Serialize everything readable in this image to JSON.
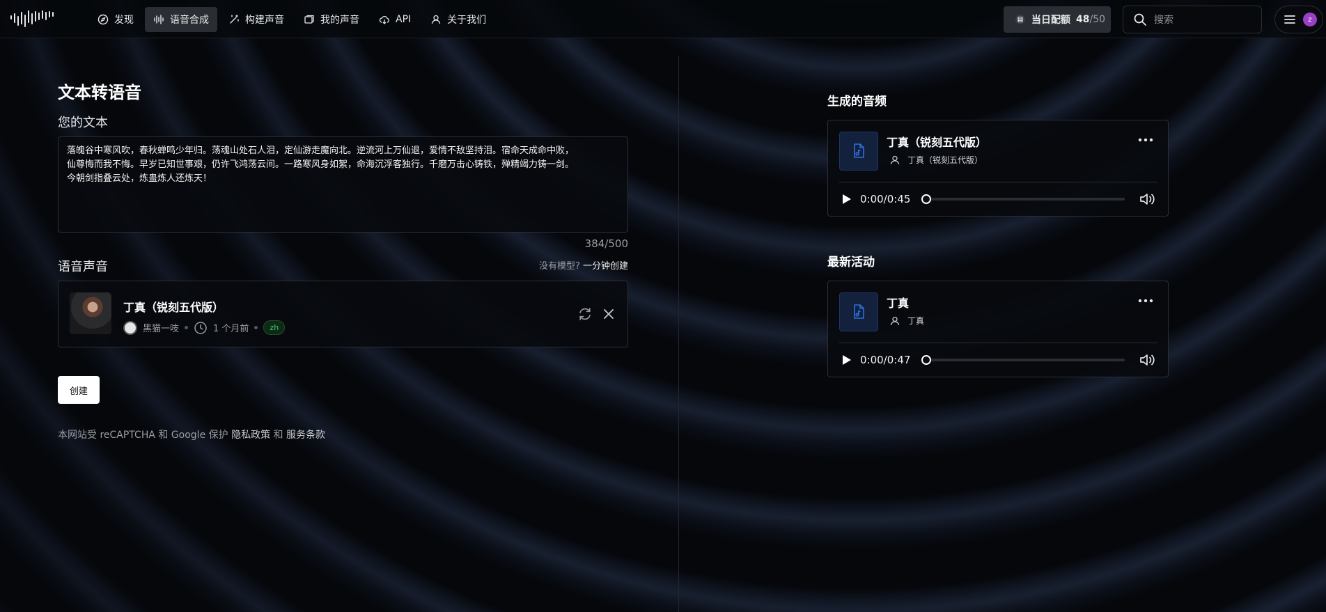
{
  "nav": {
    "items": [
      {
        "label": "发现",
        "icon": "compass-icon"
      },
      {
        "label": "语音合成",
        "icon": "waveform-icon",
        "active": true
      },
      {
        "label": "构建声音",
        "icon": "magic-wand-icon"
      },
      {
        "label": "我的声音",
        "icon": "folder-icon"
      },
      {
        "label": "API",
        "icon": "cloud-icon"
      },
      {
        "label": "关于我们",
        "icon": "user-icon"
      }
    ],
    "quota_label": "当日配额",
    "quota_used": "48",
    "quota_total": "/50",
    "search_placeholder": "搜索",
    "avatar_initial": "z"
  },
  "main": {
    "title": "文本转语音",
    "text_label": "您的文本",
    "text_value": "落魄谷中寒风吹，春秋蝉鸣少年归。荡魂山处石人泪，定仙游走魔向北。逆流河上万仙退，爱情不敌坚持泪。宿命天成命中败，\n仙尊悔而我不悔。早岁已知世事艰，仍许飞鸿荡云间。一路寒风身如絮，命海沉浮客独行。千磨万击心铸铁，殚精竭力铸一剑。\n今朝剑指叠云处，炼蛊炼人还炼天！",
    "char_count": "384/500",
    "voice_label": "语音声音",
    "no_model_text": "没有模型?",
    "create_link": "一分钟创建",
    "voice": {
      "name": "丁真（锐刻五代版）",
      "author": "黑猫一吱",
      "time": "1 个月前",
      "lang": "zh"
    },
    "create_button": "创建",
    "footer_prefix": "本网站受 reCAPTCHA 和 Google 保护",
    "privacy": "隐私政策",
    "and": "和",
    "terms": "服务条款"
  },
  "side": {
    "generated_title": "生成的音频",
    "recent_title": "最新活动",
    "generated": {
      "title": "丁真（锐刻五代版）",
      "voice": "丁真（锐刻五代版）",
      "time": "0:00/0:45",
      "progress": 0
    },
    "recent": {
      "title": "丁真",
      "voice": "丁真",
      "time": "0:00/0:47",
      "progress": 0
    }
  },
  "colors": {
    "accent_icon": "#2f6fe0",
    "lang_badge": "#3ecf6a",
    "avatar": "#9b3fc4"
  }
}
